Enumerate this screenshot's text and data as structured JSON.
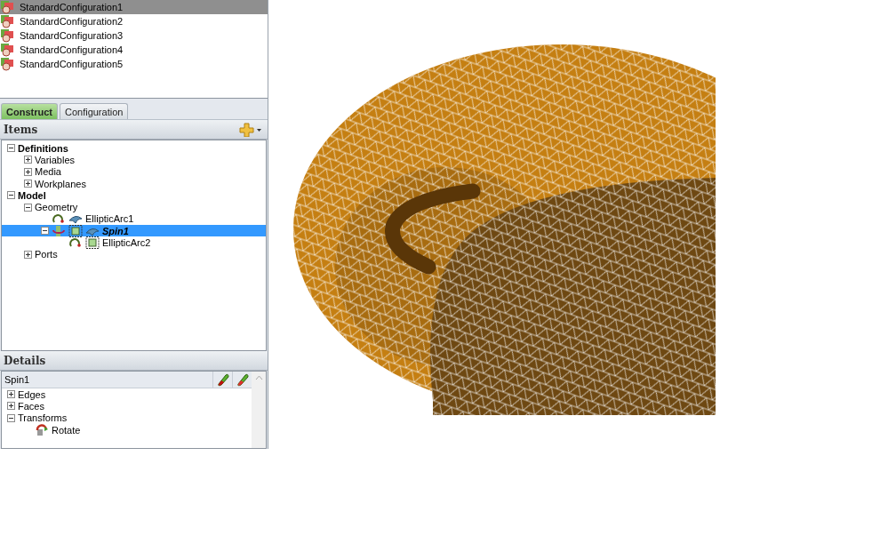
{
  "configurations": [
    {
      "label": "StandardConfiguration1",
      "selected": true
    },
    {
      "label": "StandardConfiguration2",
      "selected": false
    },
    {
      "label": "StandardConfiguration3",
      "selected": false
    },
    {
      "label": "StandardConfiguration4",
      "selected": false
    },
    {
      "label": "StandardConfiguration5",
      "selected": false
    }
  ],
  "tabs": [
    {
      "label": "Construct",
      "selected": true
    },
    {
      "label": "Configuration",
      "selected": false
    }
  ],
  "items_header": "Items",
  "tree": [
    {
      "label": "Definitions",
      "bold": true,
      "expanded": true,
      "selected": false,
      "children": [
        {
          "label": "Variables",
          "bold": false,
          "expanded": false,
          "selected": false
        },
        {
          "label": "Media",
          "bold": false,
          "expanded": false,
          "selected": false
        },
        {
          "label": "Workplanes",
          "bold": false,
          "expanded": false,
          "selected": false
        }
      ]
    },
    {
      "label": "Model",
      "bold": true,
      "expanded": true,
      "selected": false,
      "children": [
        {
          "label": "Geometry",
          "bold": false,
          "expanded": true,
          "selected": false,
          "children": [
            {
              "label": "EllipticArc1",
              "kind": "arc",
              "bold": false,
              "selected": false
            },
            {
              "label": "Spin1",
              "kind": "spin",
              "bold": true,
              "expanded": true,
              "selected": true,
              "children": [
                {
                  "label": "EllipticArc2",
                  "kind": "sub-arc",
                  "bold": false,
                  "selected": false
                }
              ]
            }
          ]
        },
        {
          "label": "Ports",
          "bold": false,
          "expanded": false,
          "selected": false
        }
      ]
    }
  ],
  "details_header": "Details",
  "details_field": "Spin1",
  "details_tree": [
    {
      "label": "Edges",
      "bold": false,
      "expanded": false,
      "selected": false
    },
    {
      "label": "Faces",
      "bold": false,
      "expanded": false,
      "selected": false
    },
    {
      "label": "Transforms",
      "bold": false,
      "expanded": true,
      "selected": false,
      "children": [
        {
          "label": "Rotate",
          "kind": "rotate",
          "bold": false,
          "selected": false
        }
      ]
    }
  ]
}
